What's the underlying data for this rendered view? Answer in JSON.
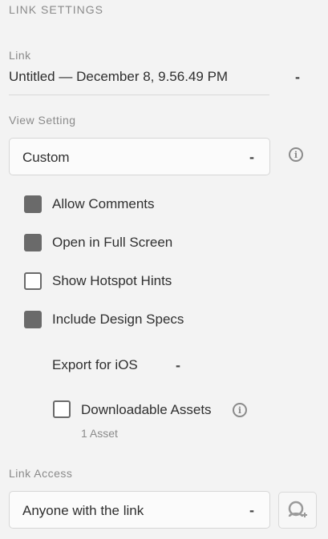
{
  "panel": {
    "title": "LINK SETTINGS"
  },
  "link": {
    "label": "Link",
    "name": "Untitled — December 8, 9.56.49 PM",
    "dropdown_glyph": "-"
  },
  "view_setting": {
    "label": "View Setting",
    "selected": "Custom",
    "dropdown_glyph": "-"
  },
  "options": [
    {
      "label": "Allow Comments",
      "checked": true
    },
    {
      "label": "Open in Full Screen",
      "checked": true
    },
    {
      "label": "Show Hotspot Hints",
      "checked": false
    },
    {
      "label": "Include Design Specs",
      "checked": true
    }
  ],
  "export": {
    "label": "Export for iOS",
    "dropdown_glyph": "-",
    "downloadable": {
      "label": "Downloadable Assets",
      "checked": false,
      "note": "1 Asset"
    }
  },
  "link_access": {
    "label": "Link Access",
    "selected": "Anyone with the link",
    "dropdown_glyph": "-"
  },
  "icons": {
    "info": "info-icon",
    "add_user": "add-user-icon",
    "info_glyph": "i"
  },
  "colors": {
    "checked": "#6a6a6a",
    "background": "#f3f3f3",
    "muted_text": "#8a8a8a"
  }
}
